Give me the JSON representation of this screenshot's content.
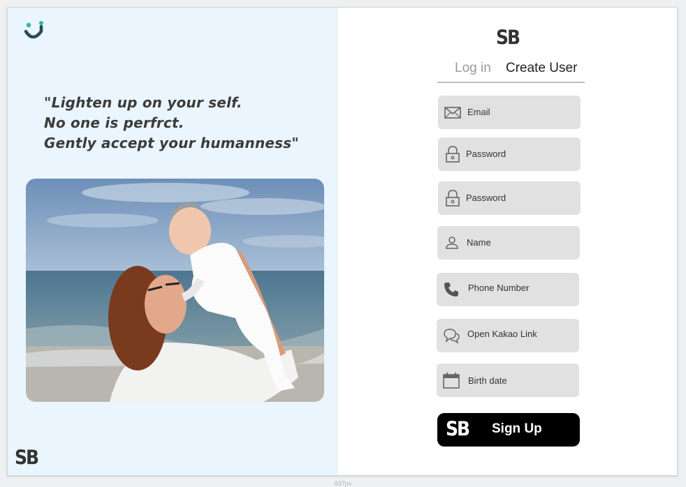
{
  "colors": {
    "left_panel_bg": "#eaf5fe",
    "logo_accent": "#2fb8a8",
    "field_bg": "#e1e1e1",
    "button_bg": "#000000"
  },
  "branding": {
    "logo_icon": "smile-logo-icon",
    "mark": "SB"
  },
  "quote": {
    "line1": "\"Lighten up on your self.",
    "line2": "No one is perfrct.",
    "line3": "Gently accept your humanness\""
  },
  "photo": {
    "description_icon": "mother-and-baby-beach-photo"
  },
  "form": {
    "title": "SB",
    "tabs": [
      {
        "label": "Log in",
        "active": false
      },
      {
        "label": "Create User",
        "active": true
      }
    ],
    "fields": [
      {
        "icon": "envelope-icon",
        "label": "Email"
      },
      {
        "icon": "lock-icon",
        "label": "Password"
      },
      {
        "icon": "lock-icon",
        "label": "Password"
      },
      {
        "icon": "person-icon",
        "label": "Name"
      },
      {
        "icon": "phone-icon",
        "label": "Phone Number"
      },
      {
        "icon": "chat-icon",
        "label": "Open Kakao Link"
      },
      {
        "icon": "calendar-icon",
        "label": "Birth date"
      }
    ],
    "submit": {
      "mark": "SB",
      "label": "Sign Up"
    }
  },
  "footer": {
    "width_note": "837px"
  }
}
